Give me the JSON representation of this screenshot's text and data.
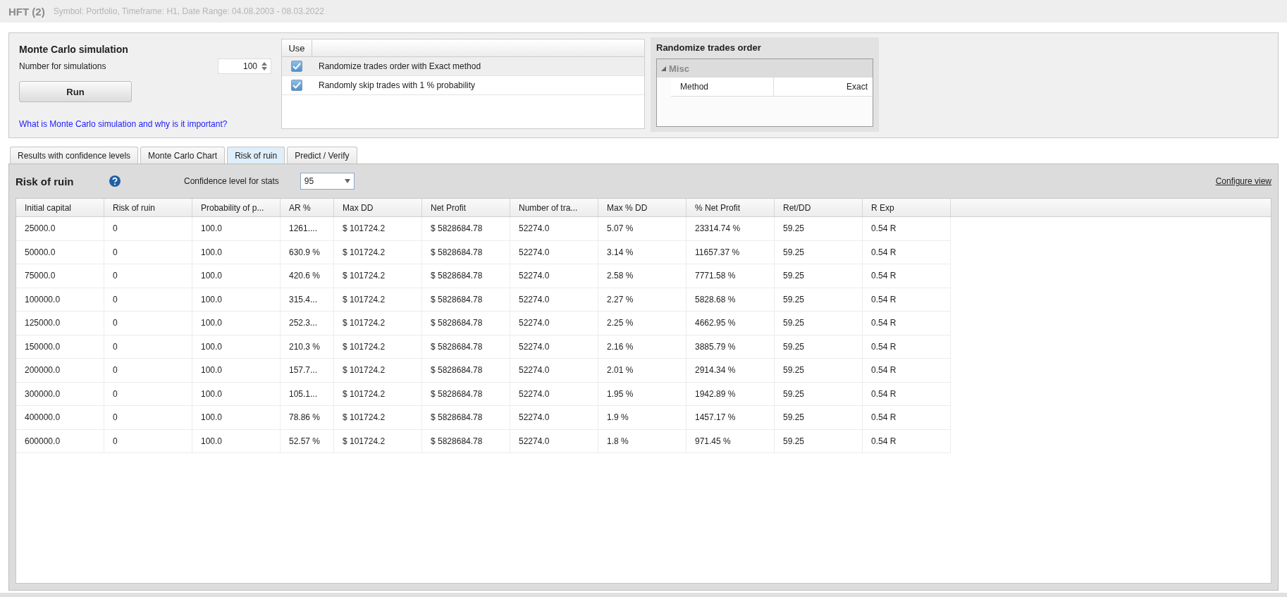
{
  "window": {
    "title": "HFT (2)",
    "subtitle": "Symbol: Portfolio, Timeframe: H1, Date Range: 04.08.2003 - 08.03.2022"
  },
  "simulation": {
    "title": "Monte Carlo simulation",
    "count_label": "Number for simulations",
    "count_value": "100",
    "run_button": "Run",
    "help_link": "What is Monte Carlo simulation and why is it important?"
  },
  "options": {
    "columns": [
      "Use"
    ],
    "rows": [
      {
        "label": "Randomize trades order with Exact method",
        "checked": true,
        "selected": true
      },
      {
        "label": "Randomly skip trades with 1 % probability",
        "checked": true,
        "selected": false
      }
    ]
  },
  "properties": {
    "title": "Randomize trades order",
    "group": {
      "label": "Misc",
      "expanded": true,
      "rows": [
        {
          "name": "Method",
          "value": "Exact"
        }
      ]
    }
  },
  "tabs": [
    {
      "label": "Results with confidence levels",
      "selected": false
    },
    {
      "label": "Monte Carlo Chart",
      "selected": false
    },
    {
      "label": "Risk of ruin",
      "selected": true
    },
    {
      "label": "Predict / Verify",
      "selected": false
    }
  ],
  "panel": {
    "title": "Risk of ruin",
    "confidence_label": "Confidence level for stats",
    "confidence_value": "95",
    "configure_link": "Configure view"
  },
  "table": {
    "columns": [
      "Initial capital",
      "Risk of ruin",
      "Probability of p...",
      "AR %",
      "Max DD",
      "Net Profit",
      "Number of tra...",
      "Max % DD",
      "% Net Profit",
      "Ret/DD",
      "R Exp"
    ],
    "rows": [
      [
        "25000.0",
        "0",
        "100.0",
        "1261....",
        "$ 101724.2",
        "$ 5828684.78",
        "52274.0",
        "5.07 %",
        "23314.74 %",
        "59.25",
        "0.54 R"
      ],
      [
        "50000.0",
        "0",
        "100.0",
        "630.9 %",
        "$ 101724.2",
        "$ 5828684.78",
        "52274.0",
        "3.14 %",
        "11657.37 %",
        "59.25",
        "0.54 R"
      ],
      [
        "75000.0",
        "0",
        "100.0",
        "420.6 %",
        "$ 101724.2",
        "$ 5828684.78",
        "52274.0",
        "2.58 %",
        "7771.58 %",
        "59.25",
        "0.54 R"
      ],
      [
        "100000.0",
        "0",
        "100.0",
        "315.4...",
        "$ 101724.2",
        "$ 5828684.78",
        "52274.0",
        "2.27 %",
        "5828.68 %",
        "59.25",
        "0.54 R"
      ],
      [
        "125000.0",
        "0",
        "100.0",
        "252.3...",
        "$ 101724.2",
        "$ 5828684.78",
        "52274.0",
        "2.25 %",
        "4662.95 %",
        "59.25",
        "0.54 R"
      ],
      [
        "150000.0",
        "0",
        "100.0",
        "210.3 %",
        "$ 101724.2",
        "$ 5828684.78",
        "52274.0",
        "2.16 %",
        "3885.79 %",
        "59.25",
        "0.54 R"
      ],
      [
        "200000.0",
        "0",
        "100.0",
        "157.7...",
        "$ 101724.2",
        "$ 5828684.78",
        "52274.0",
        "2.01 %",
        "2914.34 %",
        "59.25",
        "0.54 R"
      ],
      [
        "300000.0",
        "0",
        "100.0",
        "105.1...",
        "$ 101724.2",
        "$ 5828684.78",
        "52274.0",
        "1.95 %",
        "1942.89 %",
        "59.25",
        "0.54 R"
      ],
      [
        "400000.0",
        "0",
        "100.0",
        "78.86 %",
        "$ 101724.2",
        "$ 5828684.78",
        "52274.0",
        "1.9 %",
        "1457.17 %",
        "59.25",
        "0.54 R"
      ],
      [
        "600000.0",
        "0",
        "100.0",
        "52.57 %",
        "$ 101724.2",
        "$ 5828684.78",
        "52274.0",
        "1.8 %",
        "971.45 %",
        "59.25",
        "0.54 R"
      ]
    ]
  }
}
